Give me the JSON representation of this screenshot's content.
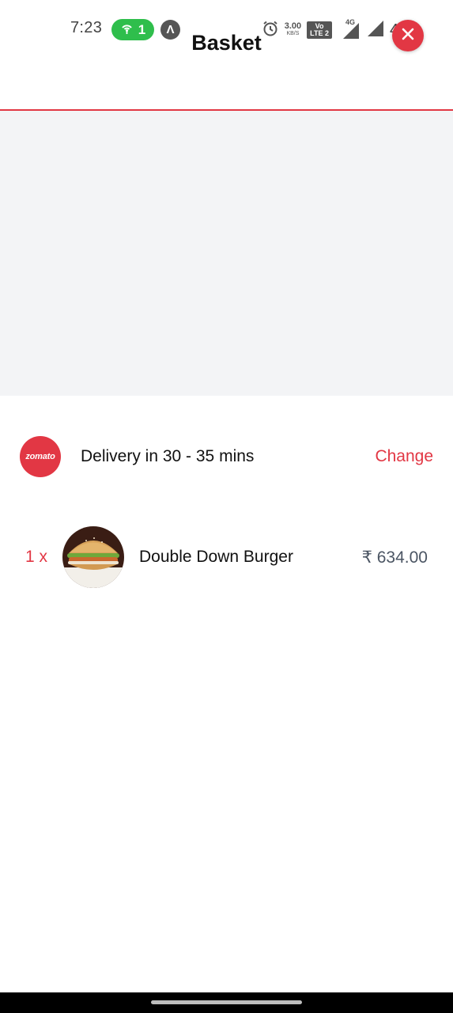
{
  "status_bar": {
    "time": "7:23",
    "hotspot_count": "1",
    "nav_badge": "Λ",
    "speed_value": "3.00",
    "speed_unit": "KB/S",
    "volte_line1": "Vo",
    "volte_line2": "LTE 2",
    "network_type": "4G",
    "battery": "43%",
    "icons": [
      "hotspot-icon",
      "alarm-icon",
      "signal-icon",
      "battery-icon"
    ]
  },
  "header": {
    "title": "Basket",
    "close_icon": "close-icon"
  },
  "delivery": {
    "logo_text": "zomato",
    "text": "Delivery in 30 - 35 mins",
    "change_label": "Change"
  },
  "items": [
    {
      "quantity": "1 x",
      "name": "Double Down Burger",
      "price": "₹ 634.00"
    }
  ],
  "colors": {
    "brand": "#e23744",
    "map_background": "#f3f4f6",
    "price_text": "#4b5563"
  }
}
